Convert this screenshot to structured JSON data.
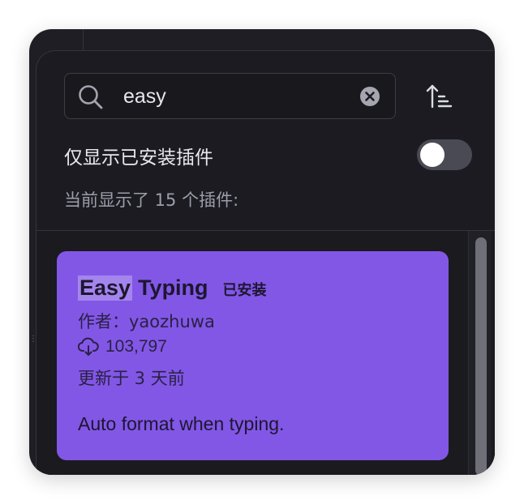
{
  "search": {
    "value": "easy",
    "placeholder": ""
  },
  "filter": {
    "installed_only_label": "仅显示已安装插件",
    "installed_only_on": false
  },
  "results": {
    "count_text": "当前显示了 15 个插件:"
  },
  "plugins": [
    {
      "title_highlight": "Easy",
      "title_rest": "Typing",
      "badge": "已安装",
      "author": "作者：yaozhuwa",
      "downloads": "103,797",
      "updated": "更新于 3 天前",
      "description": "Auto format when typing."
    }
  ],
  "icons": {
    "search": "search-icon",
    "clear": "clear-icon",
    "sort": "sort-icon",
    "download": "download-icon"
  },
  "colors": {
    "background": "#1b1b21",
    "card_accent": "#8257e6",
    "toggle_off": "#4a4a55"
  }
}
